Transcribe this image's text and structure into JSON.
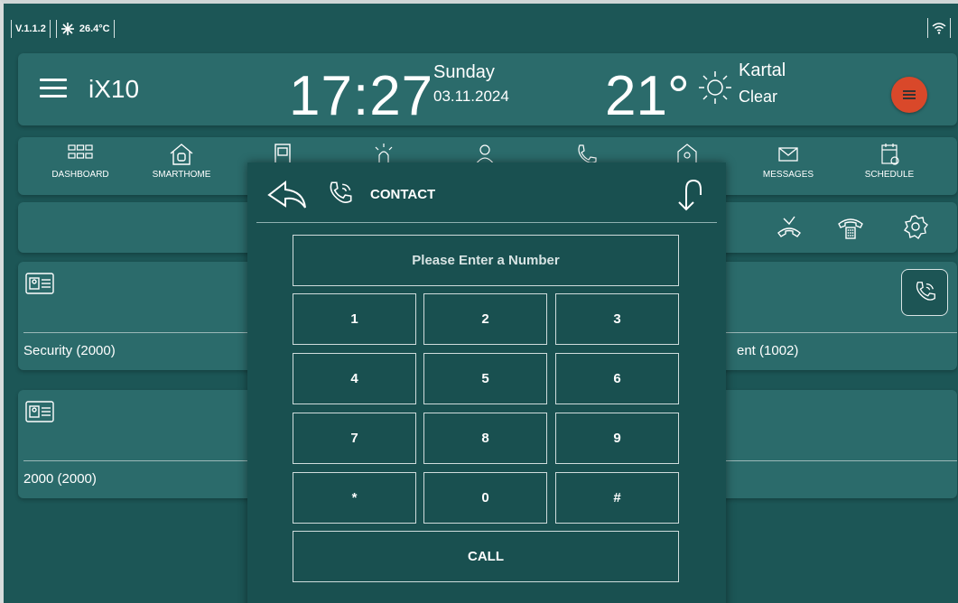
{
  "status": {
    "version": "V.1.1.2",
    "temperature": "26.4°C"
  },
  "header": {
    "app_title": "iX10",
    "time": "17:27",
    "day": "Sunday",
    "date": "03.11.2024",
    "temperature": "21°",
    "city": "Kartal",
    "condition": "Clear"
  },
  "nav": {
    "items": [
      {
        "label": "DASHBOARD",
        "icon": "grid-icon"
      },
      {
        "label": "SMARTHOME",
        "icon": "home-icon"
      },
      {
        "label": "",
        "icon": "door-icon"
      },
      {
        "label": "",
        "icon": "alarm-icon"
      },
      {
        "label": "",
        "icon": "guard-icon"
      },
      {
        "label": "",
        "icon": "phone-icon"
      },
      {
        "label": "...",
        "icon": "shield-home-icon"
      },
      {
        "label": "MESSAGES",
        "icon": "envelope-icon"
      },
      {
        "label": "SCHEDULE",
        "icon": "calendar-icon"
      }
    ]
  },
  "cards": [
    {
      "label": "Security (2000)",
      "right_label": "ent (1002)"
    },
    {
      "label": "2000 (2000)"
    }
  ],
  "dialer": {
    "title": "CONTACT",
    "placeholder": "Please Enter a Number",
    "keys": [
      "1",
      "2",
      "3",
      "4",
      "5",
      "6",
      "7",
      "8",
      "9",
      "*",
      "0",
      "#"
    ],
    "call_label": "CALL"
  },
  "colors": {
    "background": "#1c5656",
    "panel": "#2b6b6b",
    "accent": "#d9482a"
  }
}
